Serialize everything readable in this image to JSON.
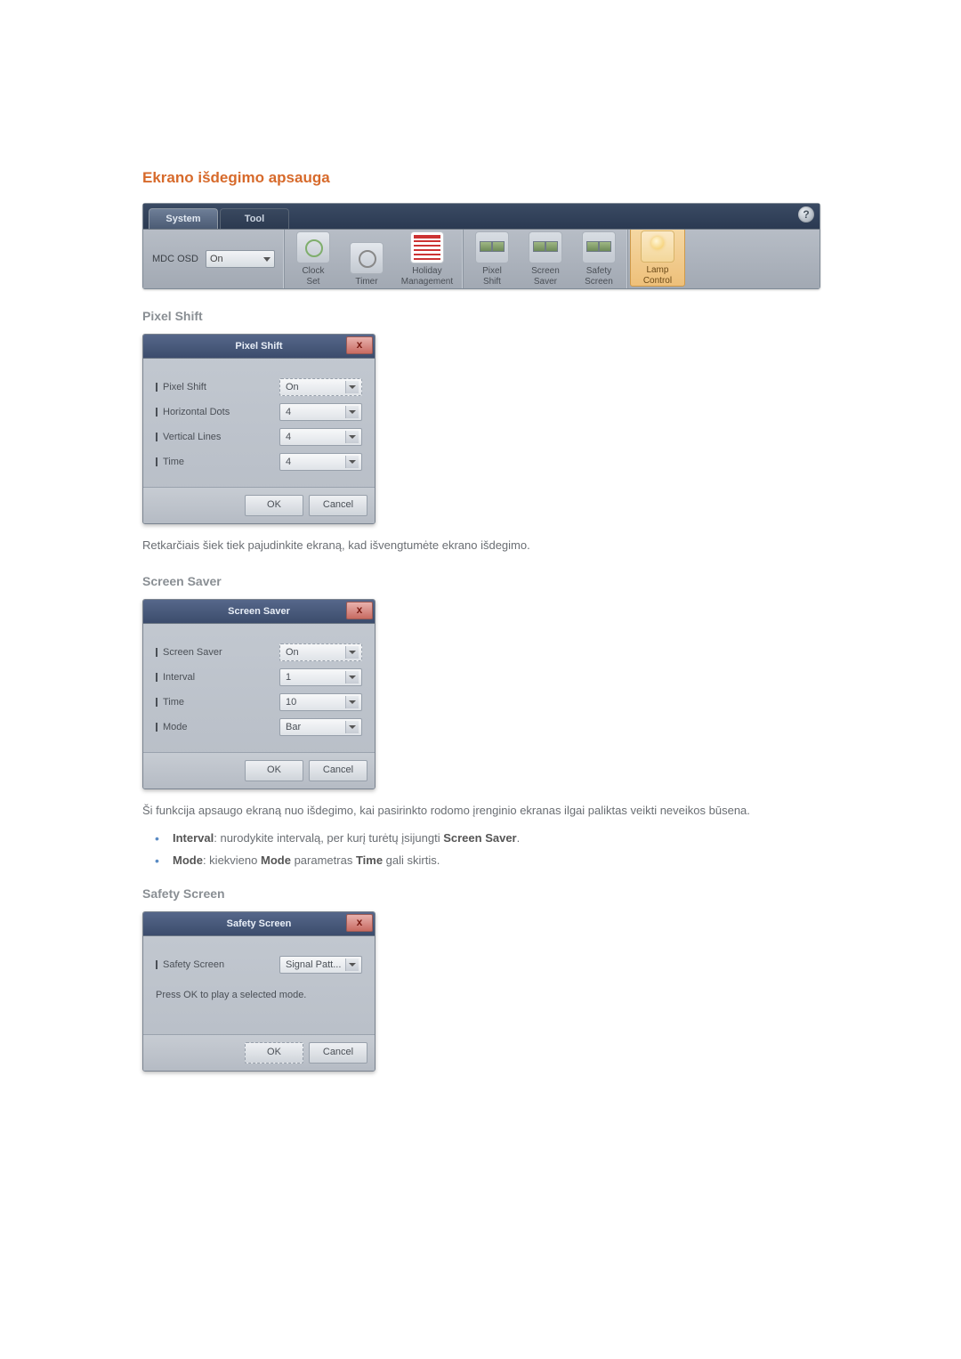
{
  "section_title": "Ekrano išdegimo apsauga",
  "toolbar": {
    "tabs": {
      "system": "System",
      "tool": "Tool"
    },
    "help": "?",
    "mdc_osd_label": "MDC OSD",
    "mdc_osd_value": "On",
    "buttons": {
      "clock_set": "Clock\nSet",
      "timer": "Timer",
      "holiday": "Holiday\nManagement",
      "pixel_shift": "Pixel\nShift",
      "screen_saver": "Screen\nSaver",
      "safety_screen": "Safety\nScreen",
      "lamp_control": "Lamp\nControl"
    }
  },
  "pixel_shift": {
    "heading": "Pixel Shift",
    "dialog_title": "Pixel Shift",
    "rows": {
      "pixel_shift_label": "Pixel Shift",
      "pixel_shift_value": "On",
      "h_dots_label": "Horizontal Dots",
      "h_dots_value": "4",
      "v_lines_label": "Vertical Lines",
      "v_lines_value": "4",
      "time_label": "Time",
      "time_value": "4"
    },
    "ok": "OK",
    "cancel": "Cancel",
    "desc": "Retkarčiais šiek tiek pajudinkite ekraną, kad išvengtumėte ekrano išdegimo."
  },
  "screen_saver": {
    "heading": "Screen Saver",
    "dialog_title": "Screen Saver",
    "rows": {
      "ss_label": "Screen Saver",
      "ss_value": "On",
      "interval_label": "Interval",
      "interval_value": "1",
      "time_label": "Time",
      "time_value": "10",
      "mode_label": "Mode",
      "mode_value": "Bar"
    },
    "ok": "OK",
    "cancel": "Cancel",
    "desc": "Ši funkcija apsaugo ekraną nuo išdegimo, kai pasirinkto rodomo įrenginio ekranas ilgai paliktas veikti neveikos būsena.",
    "bullets": {
      "interval_pre": "Interval",
      "interval_post": ": nurodykite intervalą, per kurį turėtų įsijungti ",
      "interval_end": "Screen Saver",
      "mode_pre": "Mode",
      "mode_mid1": ": kiekvieno ",
      "mode_mid2": "Mode",
      "mode_mid3": " parametras ",
      "mode_mid4": "Time",
      "mode_end": " gali skirtis."
    }
  },
  "safety_screen": {
    "heading": "Safety Screen",
    "dialog_title": "Safety Screen",
    "row_label": "Safety Screen",
    "row_value": "Signal Patt...",
    "msg": "Press OK to play a selected mode.",
    "ok": "OK",
    "cancel": "Cancel"
  },
  "close_x": "x"
}
